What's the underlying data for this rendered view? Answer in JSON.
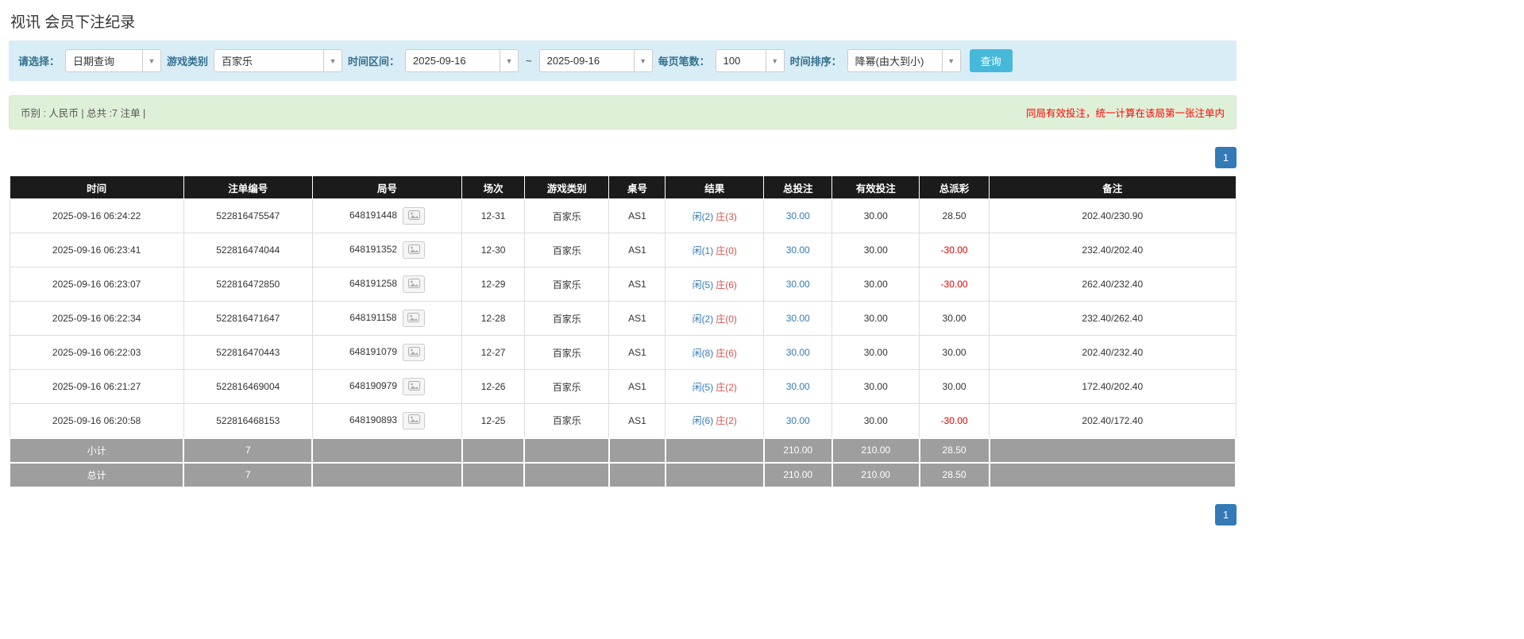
{
  "page": {
    "title": "视讯 会员下注纪录"
  },
  "filters": {
    "select_label": "请选择：",
    "select_value": "日期查询",
    "game_label": "游戏类别",
    "game_value": "百家乐",
    "range_label": "时间区间：",
    "range_from": "2025-09-16",
    "range_tilde": "~",
    "range_to": "2025-09-16",
    "per_page_label": "每页笔数：",
    "per_page_value": "100",
    "sort_label": "时间排序：",
    "sort_value": "降幂(由大到小)",
    "search_button": "查询",
    "caret": "▼"
  },
  "summary": {
    "left": "币别 : 人民币 | 总共 :7 注单 |",
    "right": "同局有效投注，统一计算在该局第一张注单内"
  },
  "pagination": {
    "page": "1"
  },
  "colors": {
    "accent_blue": "#337ab7",
    "banker_red": "#d9534f",
    "negative_red": "#e60000",
    "header_black": "#1b1b1b",
    "footer_gray": "#9e9e9e",
    "filter_bg": "#d9edf7",
    "summary_bg": "#dff0d8"
  },
  "table": {
    "headers": [
      "时间",
      "注单编号",
      "局号",
      "场次",
      "游戏类别",
      "桌号",
      "结果",
      "总投注",
      "有效投注",
      "总派彩",
      "备注"
    ],
    "rows": [
      {
        "time": "2025-09-16 06:24:22",
        "bet_id": "522816475547",
        "round": "648191448",
        "session": "12-31",
        "game": "百家乐",
        "table_no": "AS1",
        "result_player": "闲(2)",
        "result_banker": "庄(3)",
        "total_bet": "30.00",
        "valid_bet": "30.00",
        "payout": "28.50",
        "note": "202.40/230.90"
      },
      {
        "time": "2025-09-16 06:23:41",
        "bet_id": "522816474044",
        "round": "648191352",
        "session": "12-30",
        "game": "百家乐",
        "table_no": "AS1",
        "result_player": "闲(1)",
        "result_banker": "庄(0)",
        "total_bet": "30.00",
        "valid_bet": "30.00",
        "payout": "-30.00",
        "note": "232.40/202.40"
      },
      {
        "time": "2025-09-16 06:23:07",
        "bet_id": "522816472850",
        "round": "648191258",
        "session": "12-29",
        "game": "百家乐",
        "table_no": "AS1",
        "result_player": "闲(5)",
        "result_banker": "庄(6)",
        "total_bet": "30.00",
        "valid_bet": "30.00",
        "payout": "-30.00",
        "note": "262.40/232.40"
      },
      {
        "time": "2025-09-16 06:22:34",
        "bet_id": "522816471647",
        "round": "648191158",
        "session": "12-28",
        "game": "百家乐",
        "table_no": "AS1",
        "result_player": "闲(2)",
        "result_banker": "庄(0)",
        "total_bet": "30.00",
        "valid_bet": "30.00",
        "payout": "30.00",
        "note": "232.40/262.40"
      },
      {
        "time": "2025-09-16 06:22:03",
        "bet_id": "522816470443",
        "round": "648191079",
        "session": "12-27",
        "game": "百家乐",
        "table_no": "AS1",
        "result_player": "闲(8)",
        "result_banker": "庄(6)",
        "total_bet": "30.00",
        "valid_bet": "30.00",
        "payout": "30.00",
        "note": "202.40/232.40"
      },
      {
        "time": "2025-09-16 06:21:27",
        "bet_id": "522816469004",
        "round": "648190979",
        "session": "12-26",
        "game": "百家乐",
        "table_no": "AS1",
        "result_player": "闲(5)",
        "result_banker": "庄(2)",
        "total_bet": "30.00",
        "valid_bet": "30.00",
        "payout": "30.00",
        "note": "172.40/202.40"
      },
      {
        "time": "2025-09-16 06:20:58",
        "bet_id": "522816468153",
        "round": "648190893",
        "session": "12-25",
        "game": "百家乐",
        "table_no": "AS1",
        "result_player": "闲(6)",
        "result_banker": "庄(2)",
        "total_bet": "30.00",
        "valid_bet": "30.00",
        "payout": "-30.00",
        "note": "202.40/172.40"
      }
    ],
    "subtotal": {
      "label": "小计",
      "count": "7",
      "total_bet": "210.00",
      "valid_bet": "210.00",
      "payout": "28.50"
    },
    "total": {
      "label": "总计",
      "count": "7",
      "total_bet": "210.00",
      "valid_bet": "210.00",
      "payout": "28.50"
    }
  }
}
